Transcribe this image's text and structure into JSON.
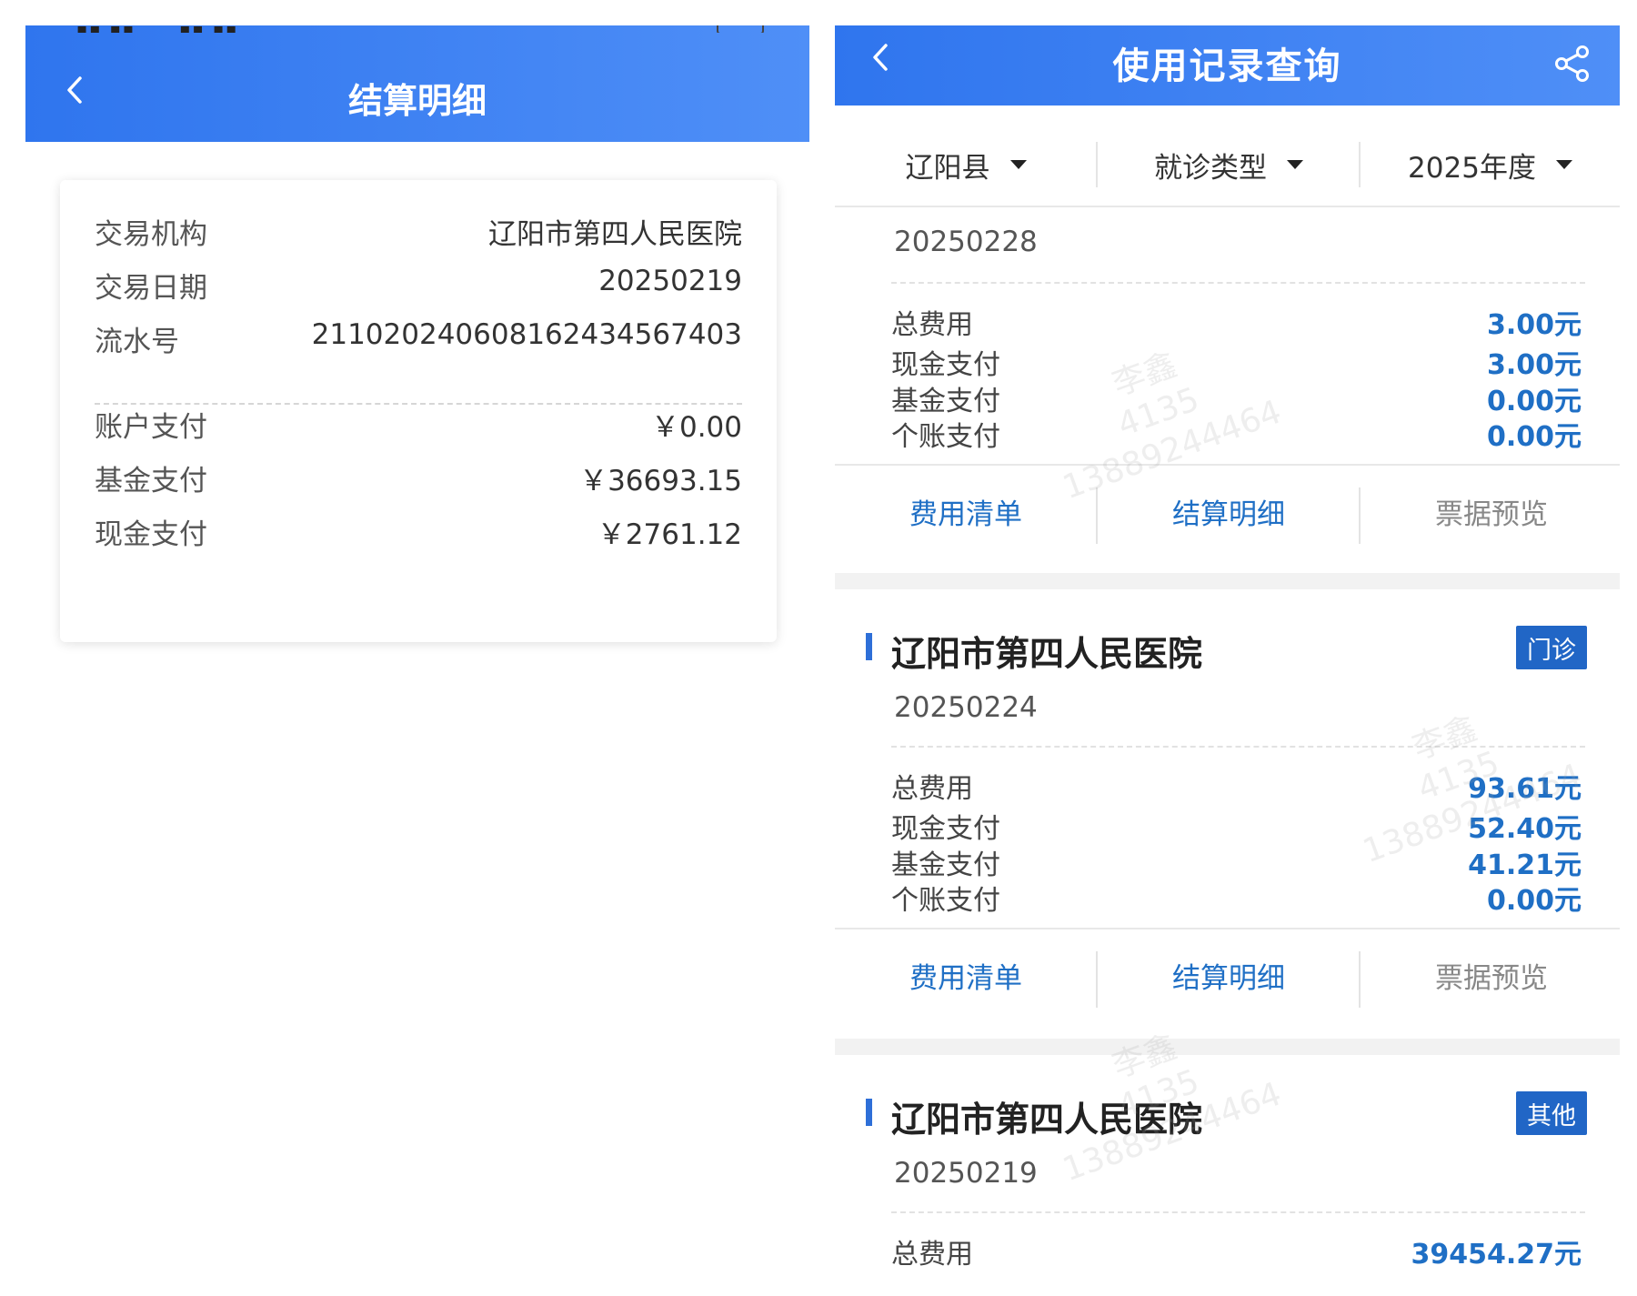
{
  "left": {
    "header": {
      "title": "结算明细"
    },
    "card": {
      "rows_top": [
        {
          "label": "交易机构",
          "value": "辽阳市第四人民医院"
        },
        {
          "label": "交易日期",
          "value": "20250219"
        },
        {
          "label": "流水号",
          "value": "21102024060816243456 7403"
        }
      ],
      "rows_bottom": [
        {
          "label": "账户支付",
          "value": "￥0.00"
        },
        {
          "label": "基金支付",
          "value": "￥36693.15"
        },
        {
          "label": "现金支付",
          "value": "￥2761.12"
        }
      ]
    }
  },
  "right": {
    "header": {
      "title": "使用记录查询"
    },
    "filters": {
      "region": "辽阳县",
      "visit_type": "就诊类型",
      "year": "2025年度"
    },
    "records": [
      {
        "date": "20250228",
        "fees": [
          {
            "label": "总费用",
            "value": "3.00元"
          },
          {
            "label": "现金支付",
            "value": "3.00元"
          },
          {
            "label": "基金支付",
            "value": "0.00元"
          },
          {
            "label": "个账支付",
            "value": "0.00元"
          }
        ],
        "actions": [
          "费用清单",
          "结算明细",
          "票据预览"
        ]
      },
      {
        "hospital": "辽阳市第四人民医院",
        "badge": "门诊",
        "date": "20250224",
        "fees": [
          {
            "label": "总费用",
            "value": "93.61元"
          },
          {
            "label": "现金支付",
            "value": "52.40元"
          },
          {
            "label": "基金支付",
            "value": "41.21元"
          },
          {
            "label": "个账支付",
            "value": "0.00元"
          }
        ],
        "actions": [
          "费用清单",
          "结算明细",
          "票据预览"
        ]
      },
      {
        "hospital": "辽阳市第四人民医院",
        "badge": "其他",
        "date": "20250219",
        "fees": [
          {
            "label": "总费用",
            "value": "39454.27元"
          }
        ]
      }
    ]
  },
  "watermark": {
    "name": "李鑫",
    "line2": "4135",
    "line3": "13889244464"
  }
}
